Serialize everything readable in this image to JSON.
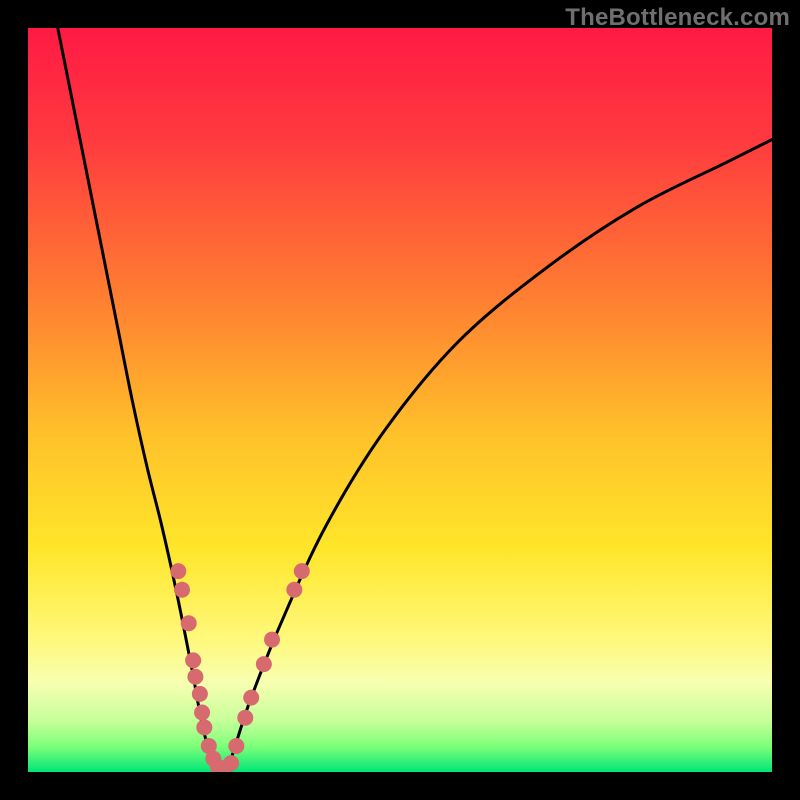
{
  "watermark": "TheBottleneck.com",
  "colors": {
    "frame": "#000000",
    "curve": "#000000",
    "dot_fill": "#d66a6f",
    "gradient_stops": [
      {
        "offset": 0.0,
        "color": "#ff1a44"
      },
      {
        "offset": 0.15,
        "color": "#ff3a3f"
      },
      {
        "offset": 0.35,
        "color": "#ff7a32"
      },
      {
        "offset": 0.55,
        "color": "#ffc22a"
      },
      {
        "offset": 0.7,
        "color": "#ffe62a"
      },
      {
        "offset": 0.82,
        "color": "#fff87a"
      },
      {
        "offset": 0.88,
        "color": "#f7ffb0"
      },
      {
        "offset": 0.93,
        "color": "#c8ff9a"
      },
      {
        "offset": 0.965,
        "color": "#7fff7a"
      },
      {
        "offset": 1.0,
        "color": "#00e676"
      }
    ]
  },
  "chart_data": {
    "type": "line",
    "title": "",
    "xlabel": "",
    "ylabel": "",
    "xlim": [
      0,
      100
    ],
    "ylim": [
      0,
      100
    ],
    "grid": false,
    "legend": false,
    "series": [
      {
        "name": "bottleneck-curve",
        "x": [
          4,
          6,
          8,
          10,
          12,
          14,
          16,
          18,
          20,
          22,
          23.5,
          25,
          26,
          27,
          28,
          30,
          34,
          40,
          48,
          58,
          70,
          82,
          94,
          100
        ],
        "y": [
          100,
          90,
          80,
          70,
          60,
          50,
          41,
          33,
          24,
          14,
          6,
          1,
          0,
          1,
          4,
          10,
          20,
          33,
          46,
          58,
          68,
          76,
          82,
          85
        ]
      }
    ],
    "scatter_dots": {
      "name": "highlighted-points",
      "points": [
        {
          "x": 20.2,
          "y": 27.0
        },
        {
          "x": 20.7,
          "y": 24.5
        },
        {
          "x": 21.6,
          "y": 20.0
        },
        {
          "x": 22.2,
          "y": 15.0
        },
        {
          "x": 22.5,
          "y": 12.8
        },
        {
          "x": 23.1,
          "y": 10.5
        },
        {
          "x": 23.4,
          "y": 8.0
        },
        {
          "x": 23.7,
          "y": 6.0
        },
        {
          "x": 24.3,
          "y": 3.5
        },
        {
          "x": 24.9,
          "y": 1.8
        },
        {
          "x": 25.5,
          "y": 0.7
        },
        {
          "x": 26.3,
          "y": 0.5
        },
        {
          "x": 27.3,
          "y": 1.2
        },
        {
          "x": 28.0,
          "y": 3.5
        },
        {
          "x": 29.2,
          "y": 7.3
        },
        {
          "x": 30.0,
          "y": 10.0
        },
        {
          "x": 31.7,
          "y": 14.5
        },
        {
          "x": 32.8,
          "y": 17.8
        },
        {
          "x": 35.8,
          "y": 24.5
        },
        {
          "x": 36.8,
          "y": 27.0
        }
      ],
      "radius": 8
    }
  }
}
